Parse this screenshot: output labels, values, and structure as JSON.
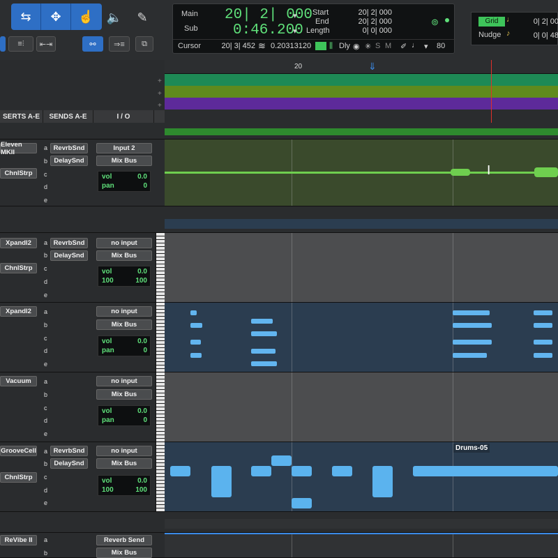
{
  "toolbar": {
    "mode_buttons": [
      "shuffle-icon",
      "slip-icon",
      "grabber-icon"
    ],
    "counter": {
      "main_label": "Main",
      "sub_label": "Sub",
      "main_value": "20| 2| 000",
      "sub_value": "0:46.200",
      "start_label": "Start",
      "end_label": "End",
      "length_label": "Length",
      "start_value": "20| 2| 000",
      "end_value": "20| 2| 000",
      "length_value": "0| 0| 000",
      "cursor_label": "Cursor",
      "cursor_value": "20| 3| 452",
      "cursor_time": "0.20313120",
      "dly_label": "Dly",
      "s_label": "S",
      "m_label": "M",
      "tempo": "80"
    },
    "grid": {
      "grid_label": "Grid",
      "nudge_label": "Nudge",
      "grid_value": "0| 2| 00",
      "nudge_value": "0| 0| 48"
    }
  },
  "columns": {
    "inserts": "SERTS A-E",
    "sends": "SENDS A-E",
    "io": "I / O"
  },
  "ruler": {
    "bar": "20"
  },
  "tracks": [
    {
      "insert": "Eleven MKII",
      "insert2": "ChnlStrp",
      "sends": [
        "RevrbSnd",
        "DelaySnd"
      ],
      "input": "Input 2",
      "output": "Mix Bus",
      "vol_label": "vol",
      "vol": "0.0",
      "pan_label": "pan",
      "pan": "0"
    },
    {
      "insert": "Xpandl2",
      "insert2": "ChnlStrp",
      "sends": [
        "RevrbSnd",
        "DelaySnd"
      ],
      "input": "no input",
      "output": "Mix Bus",
      "vol_label": "vol",
      "vol": "0.0",
      "pan_left": "100",
      "pan_right": "100"
    },
    {
      "insert": "Xpandl2",
      "input": "no input",
      "output": "Mix Bus",
      "vol_label": "vol",
      "vol": "0.0",
      "pan_label": "pan",
      "pan": "0"
    },
    {
      "insert": "Vacuum",
      "input": "no input",
      "output": "Mix Bus",
      "vol_label": "vol",
      "vol": "0.0",
      "pan_label": "pan",
      "pan": "0"
    },
    {
      "insert": "GrooveCell",
      "insert2": "ChnlStrp",
      "sends": [
        "RevrbSnd",
        "DelaySnd"
      ],
      "input": "no input",
      "output": "Mix Bus",
      "vol_label": "vol",
      "vol": "0.0",
      "pan_left": "100",
      "pan_right": "100",
      "clip_name": "Drums-05"
    },
    {
      "insert": "ReVibe II",
      "input": "Reverb Send",
      "output": "Mix Bus"
    }
  ],
  "slot_letters": [
    "a",
    "b",
    "c",
    "d",
    "e"
  ],
  "colors": {
    "counter_green": "#5fe07a",
    "marker_green": "#1e8a55",
    "marker_olive": "#5f8a1d",
    "marker_purple": "#5d2a9a",
    "audio_region": "#3a4a2c",
    "midi_region": "#2b3d50",
    "note_blue": "#62b5ef"
  }
}
